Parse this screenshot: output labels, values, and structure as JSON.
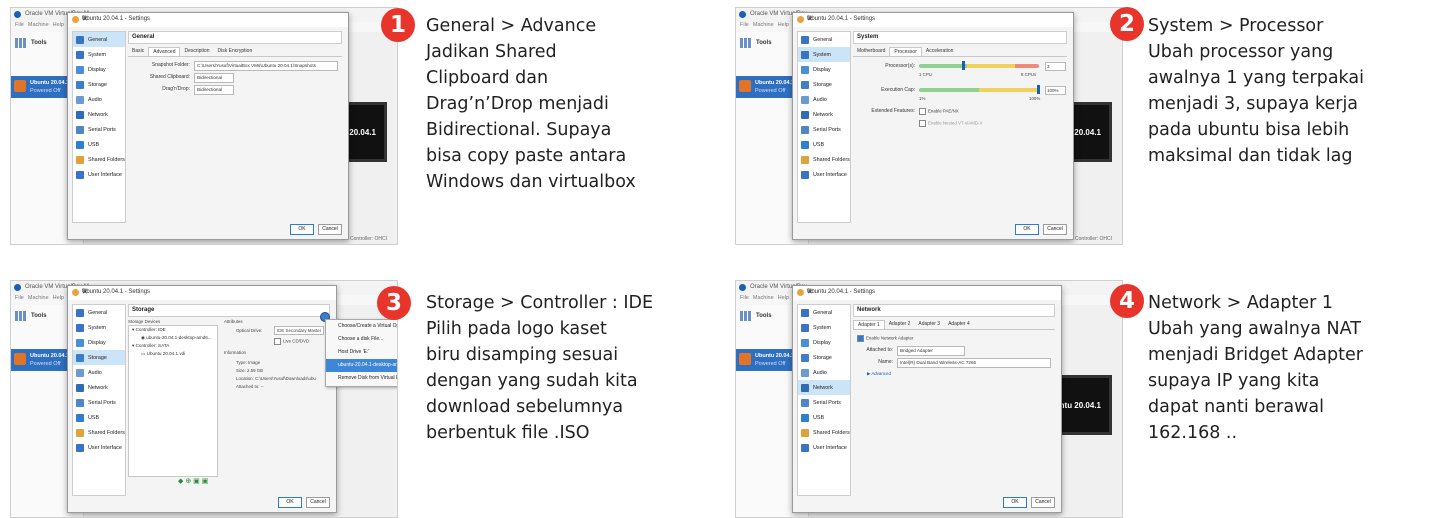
{
  "steps": [
    {
      "number": "1",
      "lines": [
        "General > Advance",
        "Jadikan Shared",
        "Clipboard dan",
        "Drag’n’Drop menjadi",
        "Bidirectional. Supaya",
        "bisa copy paste antara",
        "Windows dan virtualbox"
      ],
      "screenshot": {
        "host_title": "Oracle VM VirtualBox M",
        "host_menu": [
          "File",
          "Machine",
          "Help"
        ],
        "tools": "Tools",
        "vm_name": "Ubuntu 20.04.1",
        "vm_state": "Powered Off",
        "preview_text": "ntu 20.04.1",
        "status_text": "SB Controller: OHCI",
        "dialog_title": "Ubuntu 20.04.1 - Settings",
        "section": "General",
        "tabs": [
          "Basic",
          "Advanced",
          "Description",
          "Disk Encryption"
        ],
        "active_tab": "Advanced",
        "fields": [
          {
            "label": "Snapshot Folder:",
            "value": "C:\\Users\\Yusuf\\VirtualBox VMs\\Ubuntu 20.04.1\\Snapshots"
          },
          {
            "label": "Shared Clipboard:",
            "value": "Bidirectional"
          },
          {
            "label": "Drag'n'Drop:",
            "value": "Bidirectional"
          }
        ]
      }
    },
    {
      "number": "2",
      "lines": [
        "System > Processor",
        "Ubah processor yang",
        "awalnya 1 yang terpakai",
        "menjadi 3, supaya kerja",
        "pada ubuntu bisa lebih",
        "maksimal dan tidak lag"
      ],
      "screenshot": {
        "host_title": "Oracle VM VirtualBox",
        "dialog_title": "Ubuntu 20.04.1 - Settings",
        "section": "System",
        "tabs": [
          "Motherboard",
          "Processor",
          "Acceleration"
        ],
        "active_tab": "Processor",
        "processor_label": "Processor(s):",
        "processor_value": "3",
        "cpu_min": "1 CPU",
        "cpu_max": "8 CPUs",
        "cap_label": "Execution Cap:",
        "cap_value": "100%",
        "cap_min": "1%",
        "cap_max": "100%",
        "ext_label": "Extended Features:",
        "pae": "Enable PAE/NX",
        "nested": "Enable Nested VT-x/AMD-V",
        "preview_text": "ntu 20.04.1",
        "status_text": "SB Controller: OHCI"
      }
    },
    {
      "number": "3",
      "lines": [
        "Storage > Controller : IDE",
        "Pilih pada logo kaset",
        "biru disamping sesuai",
        "dengan yang sudah kita",
        "download sebelumnya",
        "berbentuk file .ISO"
      ],
      "screenshot": {
        "host_title": "Oracle VM VirtualBox M",
        "dialog_title": "Ubuntu 20.04.1 - Settings",
        "section": "Storage",
        "devices_label": "Storage Devices",
        "tree": [
          "Controller: IDE",
          "ubuntu-20.04.1-desktop-amd6...",
          "Controller: SATA",
          "Ubuntu 20.04.1.vdi"
        ],
        "attributes_label": "Attributes",
        "optical_label": "Optical Drive:",
        "optical_value": "IDE Secondary Master",
        "live_cd": "Live CD/DVD",
        "information_label": "Information",
        "info": [
          {
            "label": "Type:",
            "value": "Image"
          },
          {
            "label": "Size:",
            "value": "2.59 GB"
          },
          {
            "label": "Location:",
            "value": "C:\\Users\\Yusuf\\Downloads\\ubu"
          },
          {
            "label": "Attached to:",
            "value": "--"
          }
        ],
        "menu": [
          "Choose/Create a Virtual Opti",
          "Choose a disk File...",
          "Host Drive 'E:'",
          "ubuntu-20.04.1-desktop-amd",
          "Remove Disk from Virtual Dri"
        ],
        "menu_selected": "ubuntu-20.04.1-desktop-amd"
      }
    },
    {
      "number": "4",
      "lines": [
        "Network > Adapter 1",
        "Ubah yang awalnya NAT",
        "menjadi Bridget Adapter",
        "supaya IP yang kita",
        "dapat nanti berawal",
        "162.168 .."
      ],
      "screenshot": {
        "host_title": "Oracle VM VirtualBox",
        "dialog_title": "Ubuntu 20.04.1 - Settings",
        "section": "Network",
        "tabs": [
          "Adapter 1",
          "Adapter 2",
          "Adapter 3",
          "Adapter 4"
        ],
        "active_tab": "Adapter 1",
        "enable": "Enable Network Adapter",
        "attached_label": "Attached to:",
        "attached_value": "Bridged Adapter",
        "name_label": "Name:",
        "name_value": "Intel(R) Dual Band Wireless-AC 7265",
        "advanced": "Advanced",
        "preview_text": "ntu 20.04.1"
      }
    }
  ],
  "categories": [
    "General",
    "System",
    "Display",
    "Storage",
    "Audio",
    "Network",
    "Serial Ports",
    "USB",
    "Shared Folders",
    "User Interface"
  ],
  "category_colors": [
    "#3a73c4",
    "#3a73c4",
    "#4a8fd6",
    "#3d7dca",
    "#6b9bd2",
    "#2e6db4",
    "#4f86c6",
    "#2f7fd0",
    "#e0a33a",
    "#3a73c4"
  ],
  "buttons": {
    "ok": "OK",
    "cancel": "Cancel"
  },
  "accent_color": "#e8352b"
}
